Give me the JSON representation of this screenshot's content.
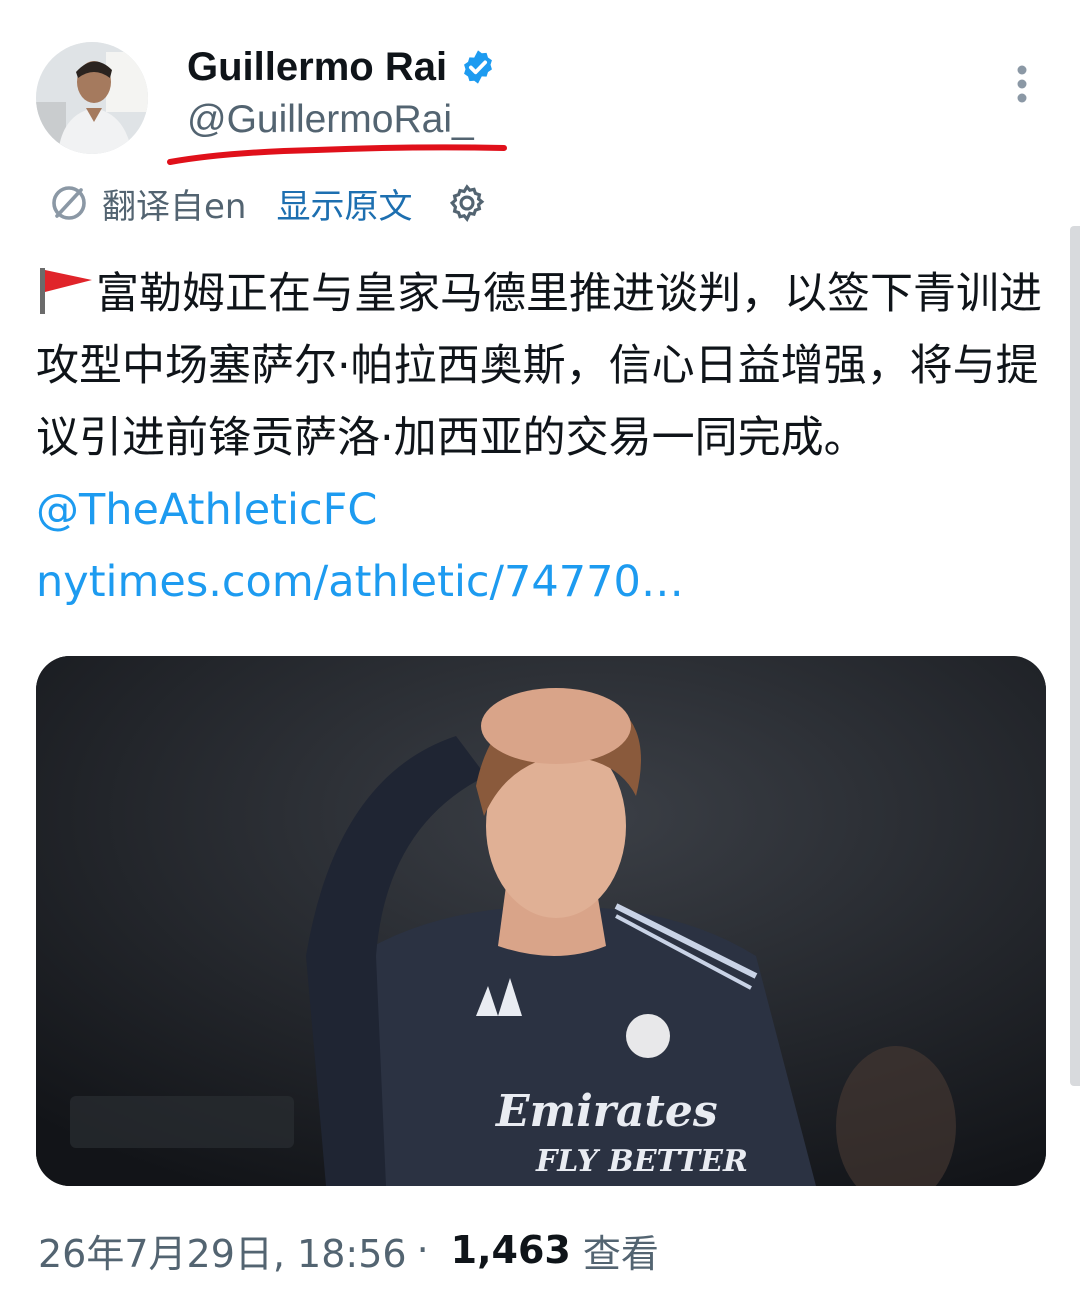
{
  "author": {
    "display_name": "Guillermo Rai",
    "handle": "@GuillermoRai_",
    "verified_icon": "verified-badge-icon",
    "avatar_icon": "avatar"
  },
  "translation": {
    "label": "翻译自en",
    "show_original": "显示原文",
    "settings_icon": "gear-icon"
  },
  "tweet": {
    "text": "富勒姆正在与皇家马德里推进谈判，以签下青训进攻型中场塞萨尔·帕拉西奥斯，信心日益增强，将与提议引进前锋贡萨洛·加西亚的交易一同完成。",
    "mention": "@TheAthleticFC",
    "link": "nytimes.com/athletic/74770…",
    "media_text": {
      "sponsor": "Emirates",
      "sponsor_line2": "FLY BETTER"
    }
  },
  "meta": {
    "date": "26年7月29日, 18:56",
    "separator": "·",
    "views": "1,463",
    "views_label": "查看"
  },
  "colors": {
    "link": "#1d9bf0",
    "secondary": "#536471",
    "underline": "#e0101a",
    "flag": "#e0242a"
  }
}
